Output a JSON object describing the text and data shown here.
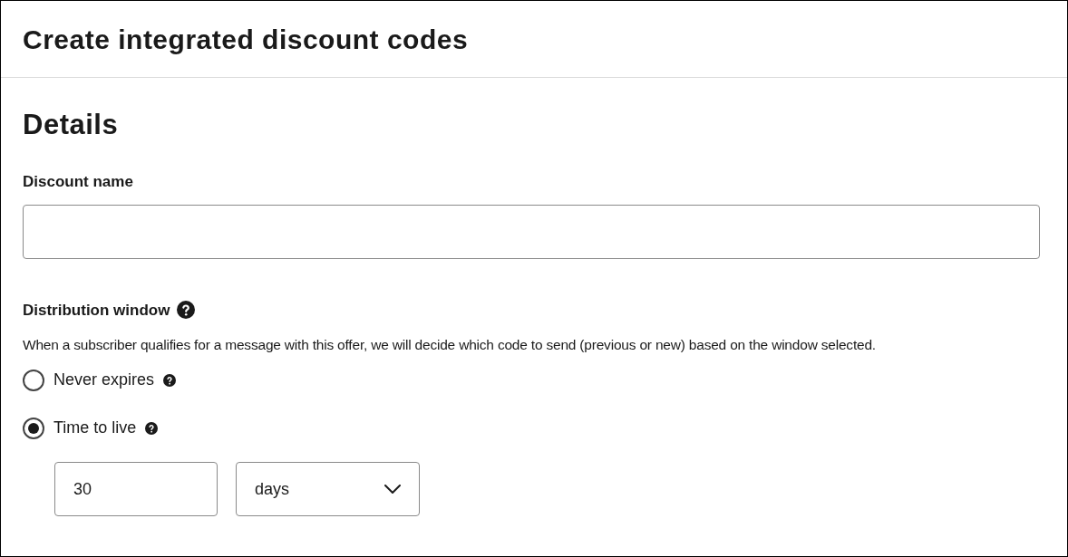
{
  "header": {
    "title": "Create integrated discount codes"
  },
  "section": {
    "title": "Details"
  },
  "discount_name": {
    "label": "Discount name"
  },
  "distribution_window": {
    "label": "Distribution window",
    "description": "When a subscriber qualifies for a message with this offer, we will decide which code to send (previous or new) based on the window selected.",
    "options": [
      {
        "label": "Never expires",
        "selected": false
      },
      {
        "label": "Time to live",
        "selected": true
      }
    ],
    "ttl_value": "30",
    "ttl_unit": "days"
  }
}
